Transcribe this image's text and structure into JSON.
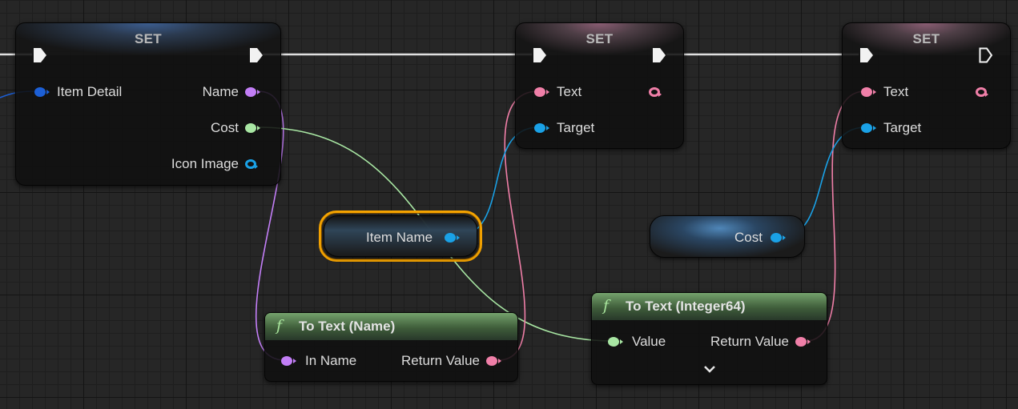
{
  "colors": {
    "name_pin": "#c27ef6",
    "int_pin": "#a8e6a3",
    "text_pin": "#f07fa8",
    "object_pin": "#1aa1e6",
    "struct_pin": "#1c5fd6",
    "exec_wire": "#e0e0e0",
    "selection": "#f4a300"
  },
  "set_node_1": {
    "title": "SET",
    "pins": {
      "item_detail": "Item Detail",
      "name": "Name",
      "cost": "Cost",
      "icon_image": "Icon Image"
    }
  },
  "set_node_2": {
    "title": "SET",
    "pins": {
      "text": "Text",
      "target": "Target"
    }
  },
  "set_node_3": {
    "title": "SET",
    "pins": {
      "text": "Text",
      "target": "Target"
    }
  },
  "get_item_name": {
    "label": "Item Name"
  },
  "get_cost": {
    "label": "Cost"
  },
  "to_text_name": {
    "icon": "function-icon",
    "icon_glyph": "f",
    "title": "To Text (Name)",
    "pins": {
      "in_name": "In Name",
      "return_value": "Return Value"
    }
  },
  "to_text_int64": {
    "icon": "function-icon",
    "icon_glyph": "f",
    "title": "To Text (Integer64)",
    "pins": {
      "value": "Value",
      "return_value": "Return Value"
    },
    "expand_icon": "chevron-down-icon"
  }
}
